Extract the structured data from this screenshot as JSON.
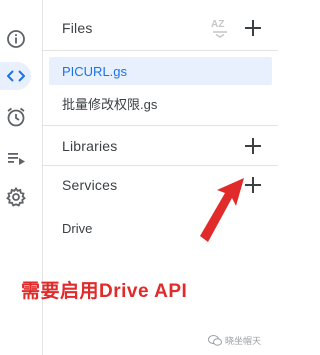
{
  "rail": {
    "icons": [
      "info-icon",
      "code-icon",
      "alarm-icon",
      "executions-icon",
      "settings-icon"
    ],
    "active": "code-icon"
  },
  "files": {
    "title": "Files",
    "sort_label": "AZ",
    "items": [
      {
        "name": "PICURL.gs",
        "active": true
      },
      {
        "name": "批量修改权限.gs",
        "active": false
      }
    ]
  },
  "libraries": {
    "title": "Libraries"
  },
  "services": {
    "title": "Services",
    "items": [
      "Drive"
    ]
  },
  "annotation": {
    "text": "需要启用Drive API",
    "color": "#e12a2a"
  },
  "watermark": {
    "text": "晓坐帽天"
  },
  "colors": {
    "accent": "#1a73e8",
    "active_bg": "#e8f0fe",
    "text": "#3c4043",
    "divider": "#e3e3e3"
  }
}
